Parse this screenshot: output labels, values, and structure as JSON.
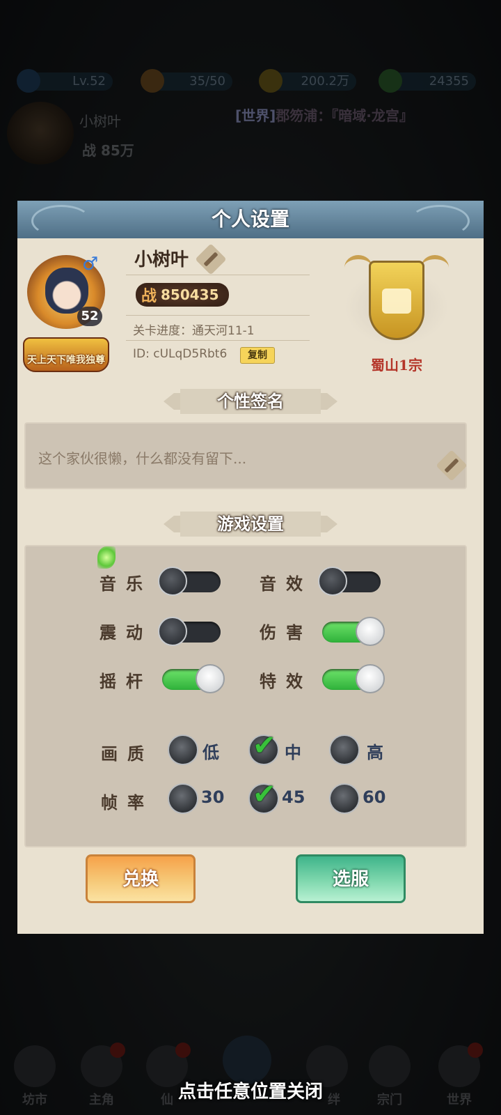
{
  "hud": {
    "level": "Lv.52",
    "stamina": "35/50",
    "gold": "200.2万",
    "jade": "24355"
  },
  "player_hud": {
    "name": "小树叶",
    "power": "战 85万"
  },
  "ticker": {
    "channel": "[世界]",
    "text": "郡笏浦：『暗域·龙宫』"
  },
  "modal": {
    "title": "个人设置",
    "profile": {
      "level": "52",
      "gender_symbol": "♂",
      "title_badge": "天上天下唯我独尊",
      "username": "小树叶",
      "power_prefix": "战",
      "power_value": "850435",
      "stage_progress": "关卡进度：通天河11-1",
      "id": "ID: cULqD5Rbt6",
      "copy_label": "复制",
      "sect": "蜀山1宗"
    },
    "signature": {
      "header": "个性签名",
      "text": "这个家伙很懒，什么都没有留下..."
    },
    "game_settings": {
      "header": "游戏设置",
      "toggles": [
        {
          "label": "音乐",
          "on": false
        },
        {
          "label": "音效",
          "on": false
        },
        {
          "label": "震动",
          "on": false
        },
        {
          "label": "伤害",
          "on": true
        },
        {
          "label": "摇杆",
          "on": true
        },
        {
          "label": "特效",
          "on": true
        }
      ],
      "quality": {
        "label": "画质",
        "options": [
          "低",
          "中",
          "高"
        ],
        "selected": "中"
      },
      "framerate": {
        "label": "帧率",
        "options": [
          "30",
          "45",
          "60"
        ],
        "selected": "45"
      }
    },
    "buttons": {
      "redeem": "兑换",
      "select_server": "选服"
    }
  },
  "bottom_nav": [
    "坊市",
    "主角",
    "仙",
    "",
    "",
    "宗门",
    "世界"
  ],
  "bottom_nav_partial": "绊",
  "close_hint": "点击任意位置关闭",
  "colors": {
    "toggle_on": "#3fc23e",
    "toggle_off": "#2c2f34",
    "check": "#38c23a",
    "modal_bg": "#e9e1d0",
    "header_bg": "#4f6f86"
  }
}
